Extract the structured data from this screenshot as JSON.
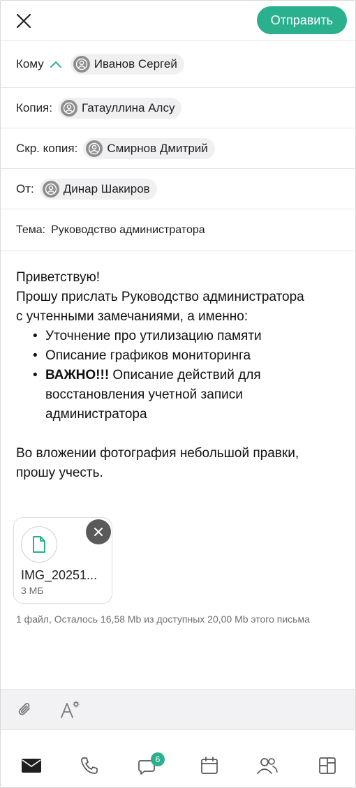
{
  "header": {
    "close_icon": "close-icon",
    "send_label": "Отправить",
    "accent_color": "#2bb08e"
  },
  "recipients": {
    "to": {
      "label": "Кому",
      "chip": "Иванов Сергей"
    },
    "cc": {
      "label": "Копия:",
      "chip": "Гатауллина Алсу"
    },
    "bcc": {
      "label": "Скр. копия:",
      "chip": "Смирнов Дмитрий"
    },
    "from": {
      "label": "От:",
      "chip": "Динар Шакиров"
    },
    "subject": {
      "label": "Тема:",
      "value": "Руководство администратора"
    }
  },
  "body": {
    "greeting": "Приветствую!",
    "line1": "Прошу прислать Руководство администратора",
    "line2": "с учтенными замечаниями, а именно:",
    "bullets": [
      {
        "text": "Уточнение про утилизацию памяти"
      },
      {
        "text": "Описание графиков мониторинга"
      },
      {
        "bold": "ВАЖНО!!!",
        "text": " Описание действий для восстановления учетной записи администратора"
      }
    ],
    "closing1": "Во вложении фотография небольшой  правки,",
    "closing2": "прошу учесть."
  },
  "attachment": {
    "name": "IMG_20251...",
    "size": "3 МБ",
    "info": "1 файл, Осталось 16,58 Mb из доступных 20,00 Mb этого письма"
  },
  "nav": {
    "chat_badge": "6",
    "items": [
      "mail-icon",
      "phone-icon",
      "chat-icon",
      "calendar-icon",
      "contacts-icon",
      "apps-icon"
    ]
  }
}
